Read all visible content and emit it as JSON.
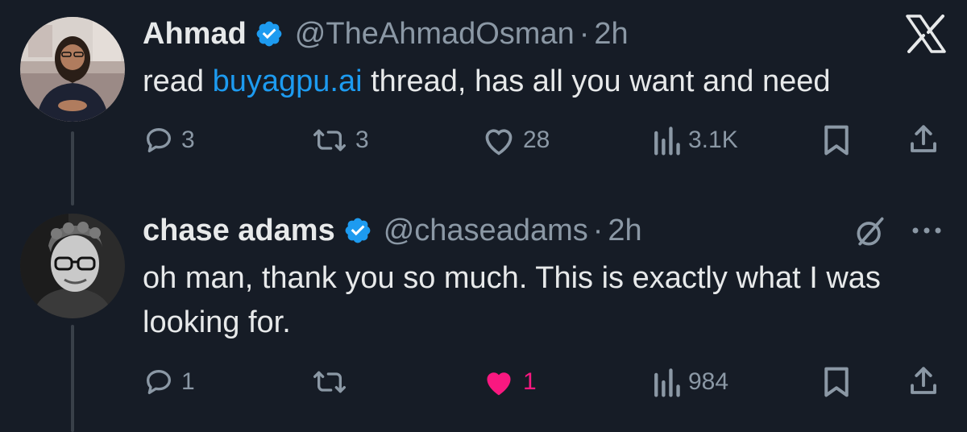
{
  "logo": {
    "icon": "x-logo-icon"
  },
  "tweets": [
    {
      "display_name": "Ahmad",
      "handle": "@TheAhmadOsman",
      "separator": "·",
      "time": "2h",
      "text_before": "read ",
      "link_text": "buyagpu.ai",
      "text_after": " thread, has all you want and need",
      "actions": {
        "replies": "3",
        "retweets": "3",
        "likes": "28",
        "views": "3.1K"
      }
    },
    {
      "display_name": "chase adams",
      "handle": "@chaseadams",
      "separator": "·",
      "time": "2h",
      "text": "oh man, thank you so much. This is exactly what I was looking for.",
      "actions": {
        "replies": "1",
        "retweets": "",
        "likes": "1",
        "likes_active": true,
        "views": "984"
      }
    }
  ],
  "colors": {
    "background": "#161c26",
    "text": "#e7e9ea",
    "muted": "#8b98a5",
    "link": "#1d9bf0",
    "verified": "#1d9bf0",
    "like_active": "#f91880",
    "thread_line": "#394049"
  }
}
